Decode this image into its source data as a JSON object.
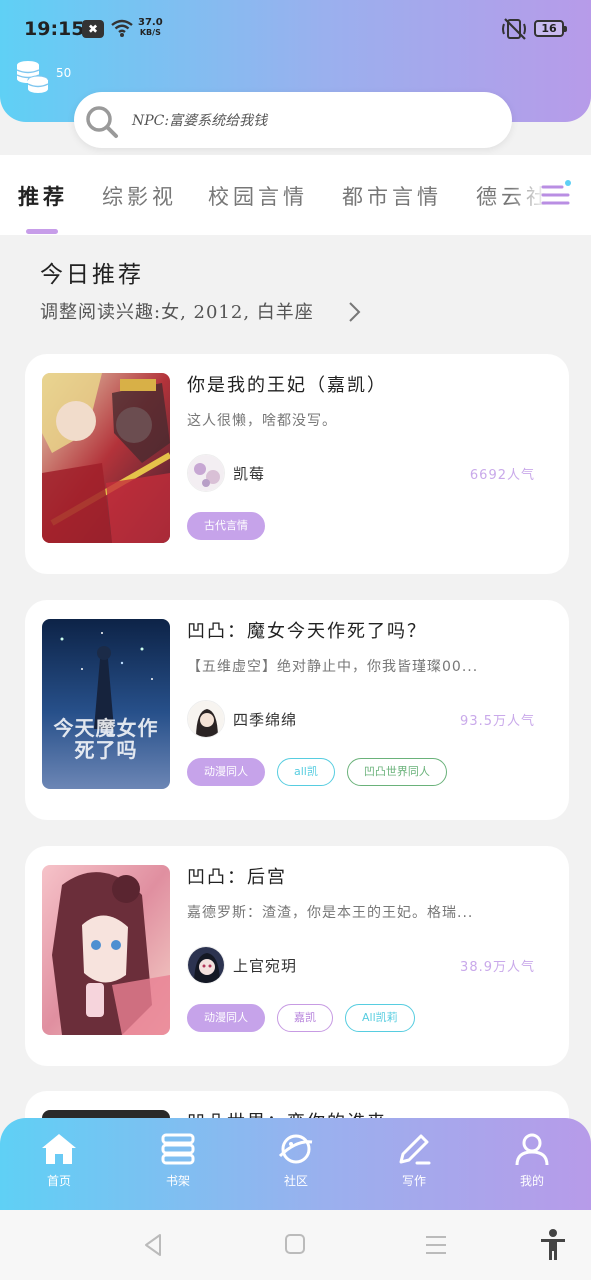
{
  "status_bar": {
    "time": "19:15",
    "net_speed_value": "37.0",
    "net_speed_unit": "KB/S",
    "battery": "16",
    "icons": [
      "notification-icon",
      "wifi-icon",
      "mute-icon",
      "battery-icon"
    ]
  },
  "header": {
    "coins": "50",
    "search_placeholder": "NPC:富婆系统给我钱"
  },
  "tabs": [
    {
      "label": "推荐",
      "active": true
    },
    {
      "label": "综影视",
      "active": false
    },
    {
      "label": "校园言情",
      "active": false
    },
    {
      "label": "都市言情",
      "active": false
    },
    {
      "label": "德云社",
      "active": false
    }
  ],
  "section": {
    "title": "今日推荐",
    "subtitle": "调整阅读兴趣:女, 2012, 白羊座"
  },
  "books": [
    {
      "title": "你是我的王妃（嘉凯）",
      "description": "这人很懒，啥都没写。",
      "author": "凯莓",
      "popularity": "6692人气",
      "tags": [
        {
          "label": "古代言情",
          "style": "purple"
        }
      ]
    },
    {
      "title": "凹凸：魔女今天作死了吗？",
      "description": "【五维虚空】绝对静止中，你我皆瑾璨00...",
      "author": "四季绵绵",
      "popularity": "93.5万人气",
      "cover_text": "今天魔女作死了吗",
      "tags": [
        {
          "label": "动漫同人",
          "style": "purple"
        },
        {
          "label": "all凯",
          "style": "cyan"
        },
        {
          "label": "凹凸世界同人",
          "style": "green"
        }
      ]
    },
    {
      "title": "凹凸：后宫",
      "description": "嘉德罗斯：渣渣，你是本王的王妃。格瑞...",
      "author": "上官宛玥",
      "popularity": "38.9万人气",
      "tags": [
        {
          "label": "动漫同人",
          "style": "purple"
        },
        {
          "label": "嘉凯",
          "style": "pink"
        },
        {
          "label": "All凯莉",
          "style": "cyan"
        }
      ]
    },
    {
      "title": "凹凸世界：变你的谁来",
      "description": "",
      "author": "",
      "popularity": "",
      "tags": []
    }
  ],
  "bottom_nav": [
    {
      "label": "首页",
      "icon": "home-icon"
    },
    {
      "label": "书架",
      "icon": "bookshelf-icon"
    },
    {
      "label": "社区",
      "icon": "planet-icon"
    },
    {
      "label": "写作",
      "icon": "pen-icon"
    },
    {
      "label": "我的",
      "icon": "user-icon"
    }
  ],
  "system_nav": [
    "back-icon",
    "home-square-icon",
    "recents-icon",
    "accessibility-icon"
  ]
}
